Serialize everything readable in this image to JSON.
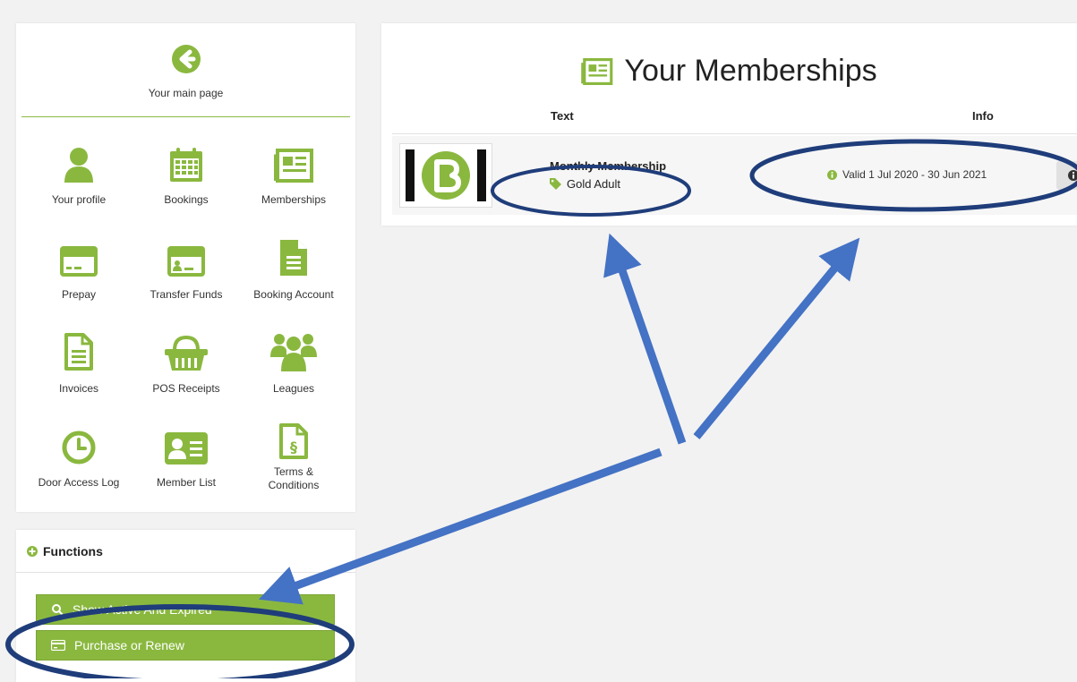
{
  "nav": {
    "back_label": "Your main page",
    "tiles": [
      {
        "label": "Your profile"
      },
      {
        "label": "Bookings"
      },
      {
        "label": "Memberships"
      },
      {
        "label": "Prepay"
      },
      {
        "label": "Transfer Funds"
      },
      {
        "label": "Booking Account"
      },
      {
        "label": "Invoices"
      },
      {
        "label": "POS Receipts"
      },
      {
        "label": "Leagues"
      },
      {
        "label": "Door Access Log"
      },
      {
        "label": "Member List"
      },
      {
        "label": "Terms & Conditions"
      }
    ]
  },
  "functions": {
    "title": "Functions",
    "buttons": [
      {
        "label": "Show Active And Expired"
      },
      {
        "label": "Purchase or Renew"
      }
    ]
  },
  "memberships": {
    "title": "Your Memberships",
    "columns": [
      "Text",
      "Info"
    ],
    "rows": [
      {
        "name": "Monthly Membership",
        "type": "Gold Adult",
        "validity": "Valid 1 Jul 2020 - 30 Jun 2021"
      }
    ]
  },
  "colors": {
    "accent": "#8ab83f",
    "annotation": "#4472c4",
    "annotation_dark": "#1f3d7a"
  },
  "icons": [
    "back-arrow-icon",
    "user-icon",
    "calendar-icon",
    "newspaper-icon",
    "credit-card-icon",
    "id-card-icon",
    "document-icon",
    "document-lines-icon",
    "basket-icon",
    "users-icon",
    "clock-icon",
    "member-card-icon",
    "legal-document-icon",
    "plus-circle-icon",
    "search-icon",
    "tag-icon",
    "info-icon"
  ]
}
